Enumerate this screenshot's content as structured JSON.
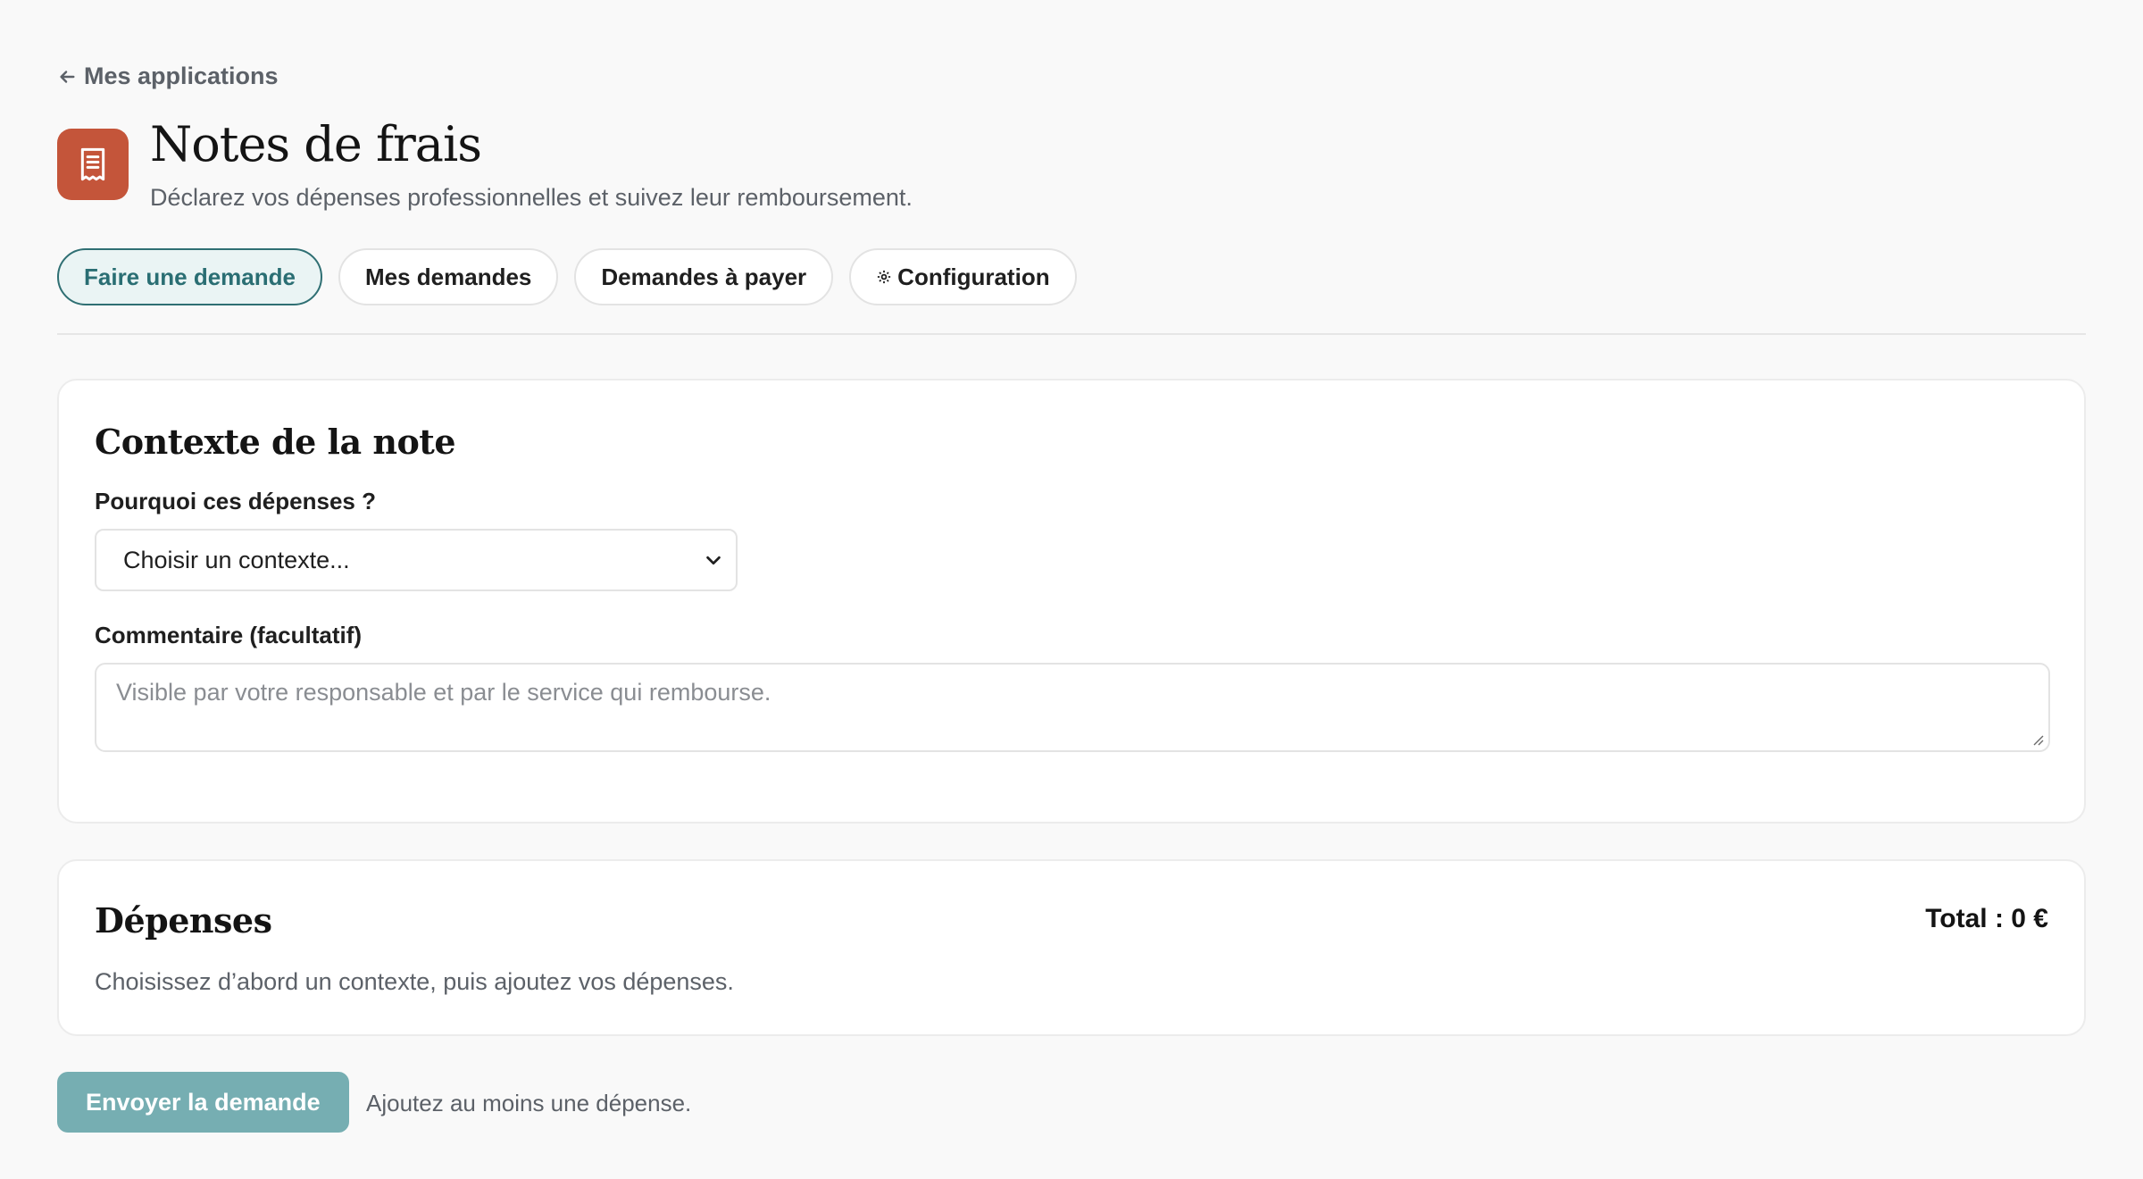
{
  "nav": {
    "back_label": "Mes applications"
  },
  "app": {
    "title": "Notes de frais",
    "subtitle": "Déclarez vos dépenses professionnelles et suivez leur remboursement.",
    "icon": "receipt-icon",
    "accent_color": "#c4553a"
  },
  "tabs": [
    {
      "label": "Faire une demande",
      "active": true
    },
    {
      "label": "Mes demandes",
      "active": false
    },
    {
      "label": "Demandes à payer",
      "active": false
    },
    {
      "label": "Configuration",
      "active": false,
      "icon": "gear-icon"
    }
  ],
  "context_card": {
    "title": "Contexte de la note",
    "why_label": "Pourquoi ces dépenses ?",
    "why_select_value": "Choisir un contexte...",
    "comment_label": "Commentaire (facultatif)",
    "comment_placeholder": "Visible par votre responsable et par le service qui rembourse."
  },
  "expenses_card": {
    "title": "Dépenses",
    "total": "Total : 0 €",
    "hint": "Choisissez d’abord un contexte, puis ajoutez vos dépenses."
  },
  "footer": {
    "submit_label": "Envoyer la demande",
    "submit_hint": "Ajoutez au moins une dépense.",
    "button_color": "#76aeb2"
  }
}
